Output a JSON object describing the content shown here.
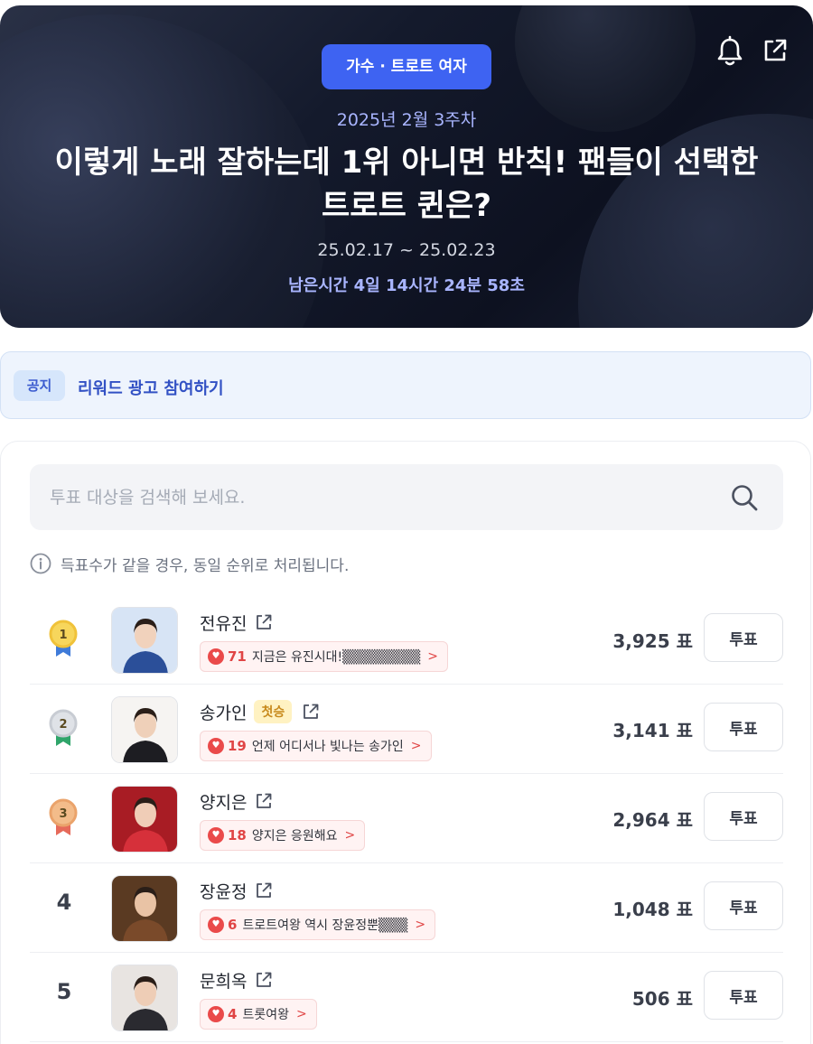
{
  "hero": {
    "category": "가수 · 트로트 여자",
    "week": "2025년 2월 3주차",
    "title": "이렇게 노래 잘하는데 1위 아니면 반칙! 팬들이 선택한 트로트 퀸은?",
    "period": "25.02.17 ~ 25.02.23",
    "remaining": "남은시간 4일 14시간 24분 58초",
    "accent_color": "#3e63f2"
  },
  "notice": {
    "tag": "공지",
    "text": "리워드 광고 참여하기"
  },
  "search": {
    "placeholder": "투표 대상을 검색해 보세요."
  },
  "info": "득표수가 같을 경우, 동일 순위로 처리됩니다.",
  "ranking": [
    {
      "rank": "1",
      "name": "전유진",
      "badge": "",
      "cheer_count": "71",
      "cheer_msg": "지금은 유진시대!▒▒▒▒▒▒▒▒",
      "votes": "3,925 표",
      "vote_label": "투표",
      "medal": "gold"
    },
    {
      "rank": "2",
      "name": "송가인",
      "badge": "첫승",
      "cheer_count": "19",
      "cheer_msg": "언제 어디서나 빛나는 송가인",
      "votes": "3,141 표",
      "vote_label": "투표",
      "medal": "silver"
    },
    {
      "rank": "3",
      "name": "양지은",
      "badge": "",
      "cheer_count": "18",
      "cheer_msg": "양지은 응원해요",
      "votes": "2,964 표",
      "vote_label": "투표",
      "medal": "bronze"
    },
    {
      "rank": "4",
      "name": "장윤정",
      "badge": "",
      "cheer_count": "6",
      "cheer_msg": "트로트여왕 역시 장윤정뿐▒▒▒",
      "votes": "1,048 표",
      "vote_label": "투표",
      "medal": ""
    },
    {
      "rank": "5",
      "name": "문희옥",
      "badge": "",
      "cheer_count": "4",
      "cheer_msg": "트롯여왕",
      "votes": "506 표",
      "vote_label": "투표",
      "medal": ""
    }
  ]
}
